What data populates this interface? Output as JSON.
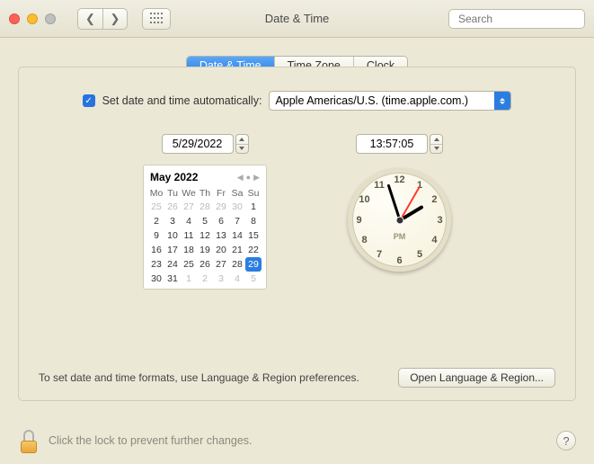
{
  "window": {
    "title": "Date & Time",
    "search_placeholder": "Search"
  },
  "tabs": [
    {
      "label": "Date & Time",
      "active": true
    },
    {
      "label": "Time Zone",
      "active": false
    },
    {
      "label": "Clock",
      "active": false
    }
  ],
  "auto": {
    "checked": true,
    "label": "Set date and time automatically:",
    "server": "Apple Americas/U.S. (time.apple.com.)"
  },
  "date_field": "5/29/2022",
  "time_field": "13:57:05",
  "calendar": {
    "title": "May 2022",
    "dow": [
      "Mo",
      "Tu",
      "We",
      "Th",
      "Fr",
      "Sa",
      "Su"
    ],
    "weeks": [
      [
        {
          "d": "25",
          "out": true
        },
        {
          "d": "26",
          "out": true
        },
        {
          "d": "27",
          "out": true
        },
        {
          "d": "28",
          "out": true
        },
        {
          "d": "29",
          "out": true
        },
        {
          "d": "30",
          "out": true
        },
        {
          "d": "1"
        }
      ],
      [
        {
          "d": "2"
        },
        {
          "d": "3"
        },
        {
          "d": "4"
        },
        {
          "d": "5"
        },
        {
          "d": "6"
        },
        {
          "d": "7"
        },
        {
          "d": "8"
        }
      ],
      [
        {
          "d": "9"
        },
        {
          "d": "10"
        },
        {
          "d": "11"
        },
        {
          "d": "12"
        },
        {
          "d": "13"
        },
        {
          "d": "14"
        },
        {
          "d": "15"
        }
      ],
      [
        {
          "d": "16"
        },
        {
          "d": "17"
        },
        {
          "d": "18"
        },
        {
          "d": "19"
        },
        {
          "d": "20"
        },
        {
          "d": "21"
        },
        {
          "d": "22"
        }
      ],
      [
        {
          "d": "23"
        },
        {
          "d": "24"
        },
        {
          "d": "25"
        },
        {
          "d": "26"
        },
        {
          "d": "27"
        },
        {
          "d": "28"
        },
        {
          "d": "29",
          "sel": true
        }
      ],
      [
        {
          "d": "30"
        },
        {
          "d": "31"
        },
        {
          "d": "1",
          "out": true
        },
        {
          "d": "2",
          "out": true
        },
        {
          "d": "3",
          "out": true
        },
        {
          "d": "4",
          "out": true
        },
        {
          "d": "5",
          "out": true
        }
      ]
    ]
  },
  "clock": {
    "ampm": "PM",
    "hour_angle": 59,
    "minute_angle": 342,
    "second_angle": 30,
    "numbers": [
      "12",
      "1",
      "2",
      "3",
      "4",
      "5",
      "6",
      "7",
      "8",
      "9",
      "10",
      "11"
    ]
  },
  "footer": {
    "text": "To set date and time formats, use Language & Region preferences.",
    "button": "Open Language & Region..."
  },
  "lock": {
    "text": "Click the lock to prevent further changes."
  },
  "help_glyph": "?"
}
